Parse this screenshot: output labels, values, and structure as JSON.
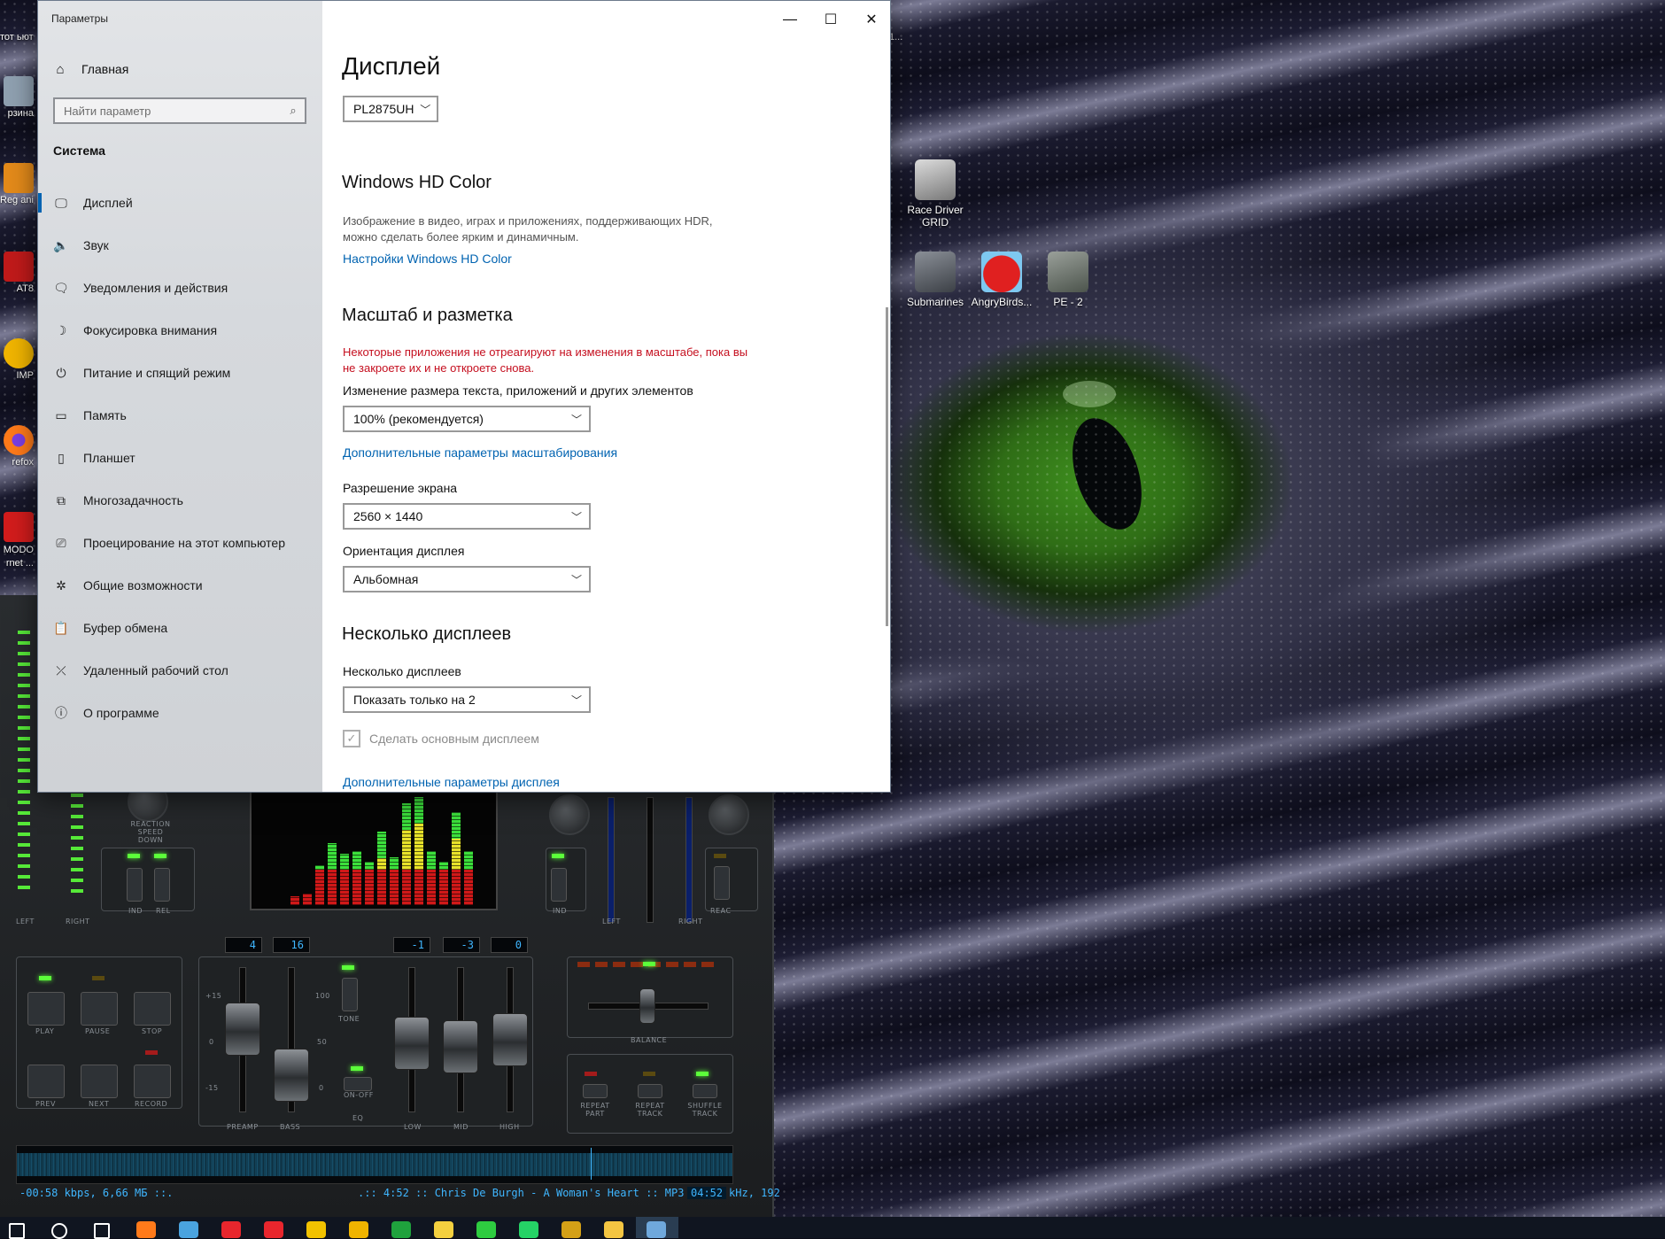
{
  "settings": {
    "window_title": "Параметры",
    "home_label": "Главная",
    "search_placeholder": "Найти параметр",
    "section_title": "Система",
    "nav_items": [
      {
        "label": "Дисплей",
        "icon": "monitor-icon",
        "glyph": "🖵"
      },
      {
        "label": "Звук",
        "icon": "speaker-icon",
        "glyph": "🔈"
      },
      {
        "label": "Уведомления и действия",
        "icon": "notification-icon",
        "glyph": "🗨"
      },
      {
        "label": "Фокусировка внимания",
        "icon": "moon-icon",
        "glyph": "☽"
      },
      {
        "label": "Питание и спящий режим",
        "icon": "power-icon",
        "glyph": "⏻"
      },
      {
        "label": "Память",
        "icon": "storage-icon",
        "glyph": "▭"
      },
      {
        "label": "Планшет",
        "icon": "tablet-icon",
        "glyph": "▯"
      },
      {
        "label": "Многозадачность",
        "icon": "multitask-icon",
        "glyph": "⧉"
      },
      {
        "label": "Проецирование на этот компьютер",
        "icon": "project-icon",
        "glyph": "⎚"
      },
      {
        "label": "Общие возможности",
        "icon": "shared-icon",
        "glyph": "✲"
      },
      {
        "label": "Буфер обмена",
        "icon": "clipboard-icon",
        "glyph": "📋"
      },
      {
        "label": "Удаленный рабочий стол",
        "icon": "remote-desktop-icon",
        "glyph": "⤫"
      },
      {
        "label": "О программе",
        "icon": "info-icon",
        "glyph": "ⓘ"
      }
    ],
    "page_title": "Дисплей",
    "monitor_select": "PL2875UH",
    "hdr_heading": "Windows HD Color",
    "hdr_desc": "Изображение в видео, играх и приложениях, поддерживающих HDR, можно сделать более ярким и динамичным.",
    "hdr_link": "Настройки Windows HD Color",
    "scale_heading": "Масштаб и разметка",
    "scale_warning": "Некоторые приложения не отреагируют на изменения в масштабе, пока вы не закроете их и не откроете снова.",
    "scale_label": "Изменение размера текста, приложений и других элементов",
    "scale_value": "100% (рекомендуется)",
    "scale_link": "Дополнительные параметры масштабирования",
    "resolution_label": "Разрешение экрана",
    "resolution_value": "2560 × 1440",
    "orientation_label": "Ориентация дисплея",
    "orientation_value": "Альбомная",
    "multi_heading": "Несколько дисплеев",
    "multi_label": "Несколько дисплеев",
    "multi_value": "Показать только на 2",
    "main_display_checkbox": "Сделать основным дисплеем",
    "advanced_link": "Дополнительные параметры дисплея"
  },
  "desktop": {
    "icons": [
      {
        "label": "Race Driver GRID"
      },
      {
        "label": "Submarines"
      },
      {
        "label": "AngryBirds..."
      },
      {
        "label": "PE - 2"
      }
    ],
    "left_icons": [
      {
        "label": "тот ьютер"
      },
      {
        "label": "рзина"
      },
      {
        "label": "Reg anizer"
      },
      {
        "label": "AT8"
      },
      {
        "label": "IMP"
      },
      {
        "label": "refox"
      },
      {
        "label": "MODO rnet ..."
      }
    ],
    "stray_text": "1..."
  },
  "player": {
    "lcd_values": [
      "4",
      "16",
      "-1",
      "-3",
      "0"
    ],
    "labels": {
      "reaction": "REACTION SPEED DOWN",
      "ind": "IND",
      "rel": "REL",
      "reac": "REAC",
      "on": "ON",
      "off": "OFF",
      "left": "LEFT",
      "right": "RIGHT",
      "play": "PLAY",
      "pause": "PAUSE",
      "stop": "STOP",
      "prev": "PREV",
      "next": "NEXT",
      "record": "RECORD",
      "preamp": "PREAMP",
      "bass": "BASS",
      "tone": "TONE",
      "on_off": "ON-OFF",
      "eq": "EQ",
      "low": "LOW",
      "mid": "MID",
      "high": "HIGH",
      "balance": "BALANCE",
      "repeat_part": "REPEAT PART",
      "repeat_track": "REPEAT TRACK",
      "shuffle_track": "SHUFFLE TRACK",
      "scale_p15": "+15",
      "scale_0": "0",
      "scale_m15": "-15",
      "scale_100": "100",
      "scale_50": "50"
    },
    "status_left": "-00:58 kbps, 6,66 МБ ::.",
    "status_right": ".:: 4:52 :: Chris De Burgh - A Woman's Heart :: MP3 :: 44 kHz, 192",
    "time": "04:52",
    "spectrum_levels": [
      0.08,
      0.1,
      0.35,
      0.55,
      0.45,
      0.48,
      0.38,
      0.65,
      0.42,
      0.9,
      0.95,
      0.48,
      0.38,
      0.82,
      0.48
    ],
    "colors": {
      "lcd": "#3fb6ff",
      "led": "#5cff3a",
      "bar_red": "#d01818",
      "bar_yellow": "#e8e22a",
      "bar_green": "#3ce03c"
    }
  },
  "taskbar": {
    "icons": [
      "start-icon",
      "search-icon",
      "task-view-icon",
      "firefox-icon",
      "chrome-icon",
      "opera-icon",
      "opera-gx-icon",
      "winamp-icon",
      "aimp-icon",
      "hwmonitor-icon",
      "star-icon",
      "tree-icon",
      "whatsapp-icon",
      "game-icon",
      "explorer-icon",
      "settings-icon"
    ]
  },
  "colors": {
    "accent": "#0063b1",
    "warning": "#c50f1f"
  }
}
